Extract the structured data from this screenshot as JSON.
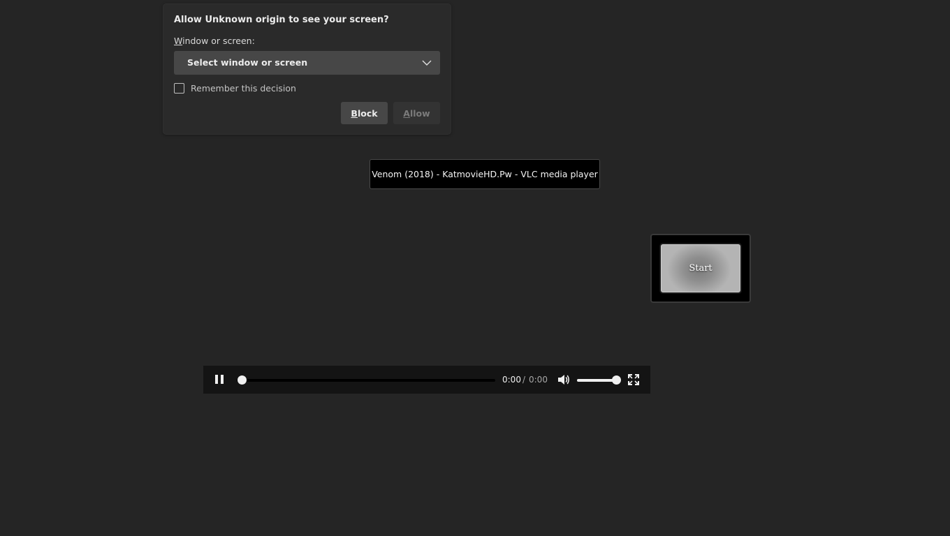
{
  "permission_dialog": {
    "title": "Allow Unknown origin to see your screen?",
    "window_label_accesskey": "W",
    "window_label_rest": "indow or screen:",
    "select": {
      "value": "Select window or screen",
      "icon": "chevron-down-icon"
    },
    "remember": {
      "label": "Remember this decision",
      "checked": false
    },
    "block_button": {
      "accesskey": "B",
      "rest": "lock"
    },
    "allow_button": {
      "accesskey": "A",
      "rest": "llow",
      "enabled": false
    }
  },
  "tooltip": {
    "text": "Venom (2018) - KatmovieHD.Pw - VLC media player"
  },
  "start_button": {
    "label": "Start"
  },
  "media_controls": {
    "play_state_icon": "pause-icon",
    "progress_fraction": 0,
    "current_time": "0:00",
    "separator": "/",
    "duration": "0:00",
    "volume_icon": "speaker-icon",
    "volume_fraction": 1,
    "fullscreen_icon": "fullscreen-icon"
  },
  "colors": {
    "background": "#252525",
    "panel": "#2a2a2a",
    "button": "#474747",
    "controls_bar": "#141414"
  }
}
